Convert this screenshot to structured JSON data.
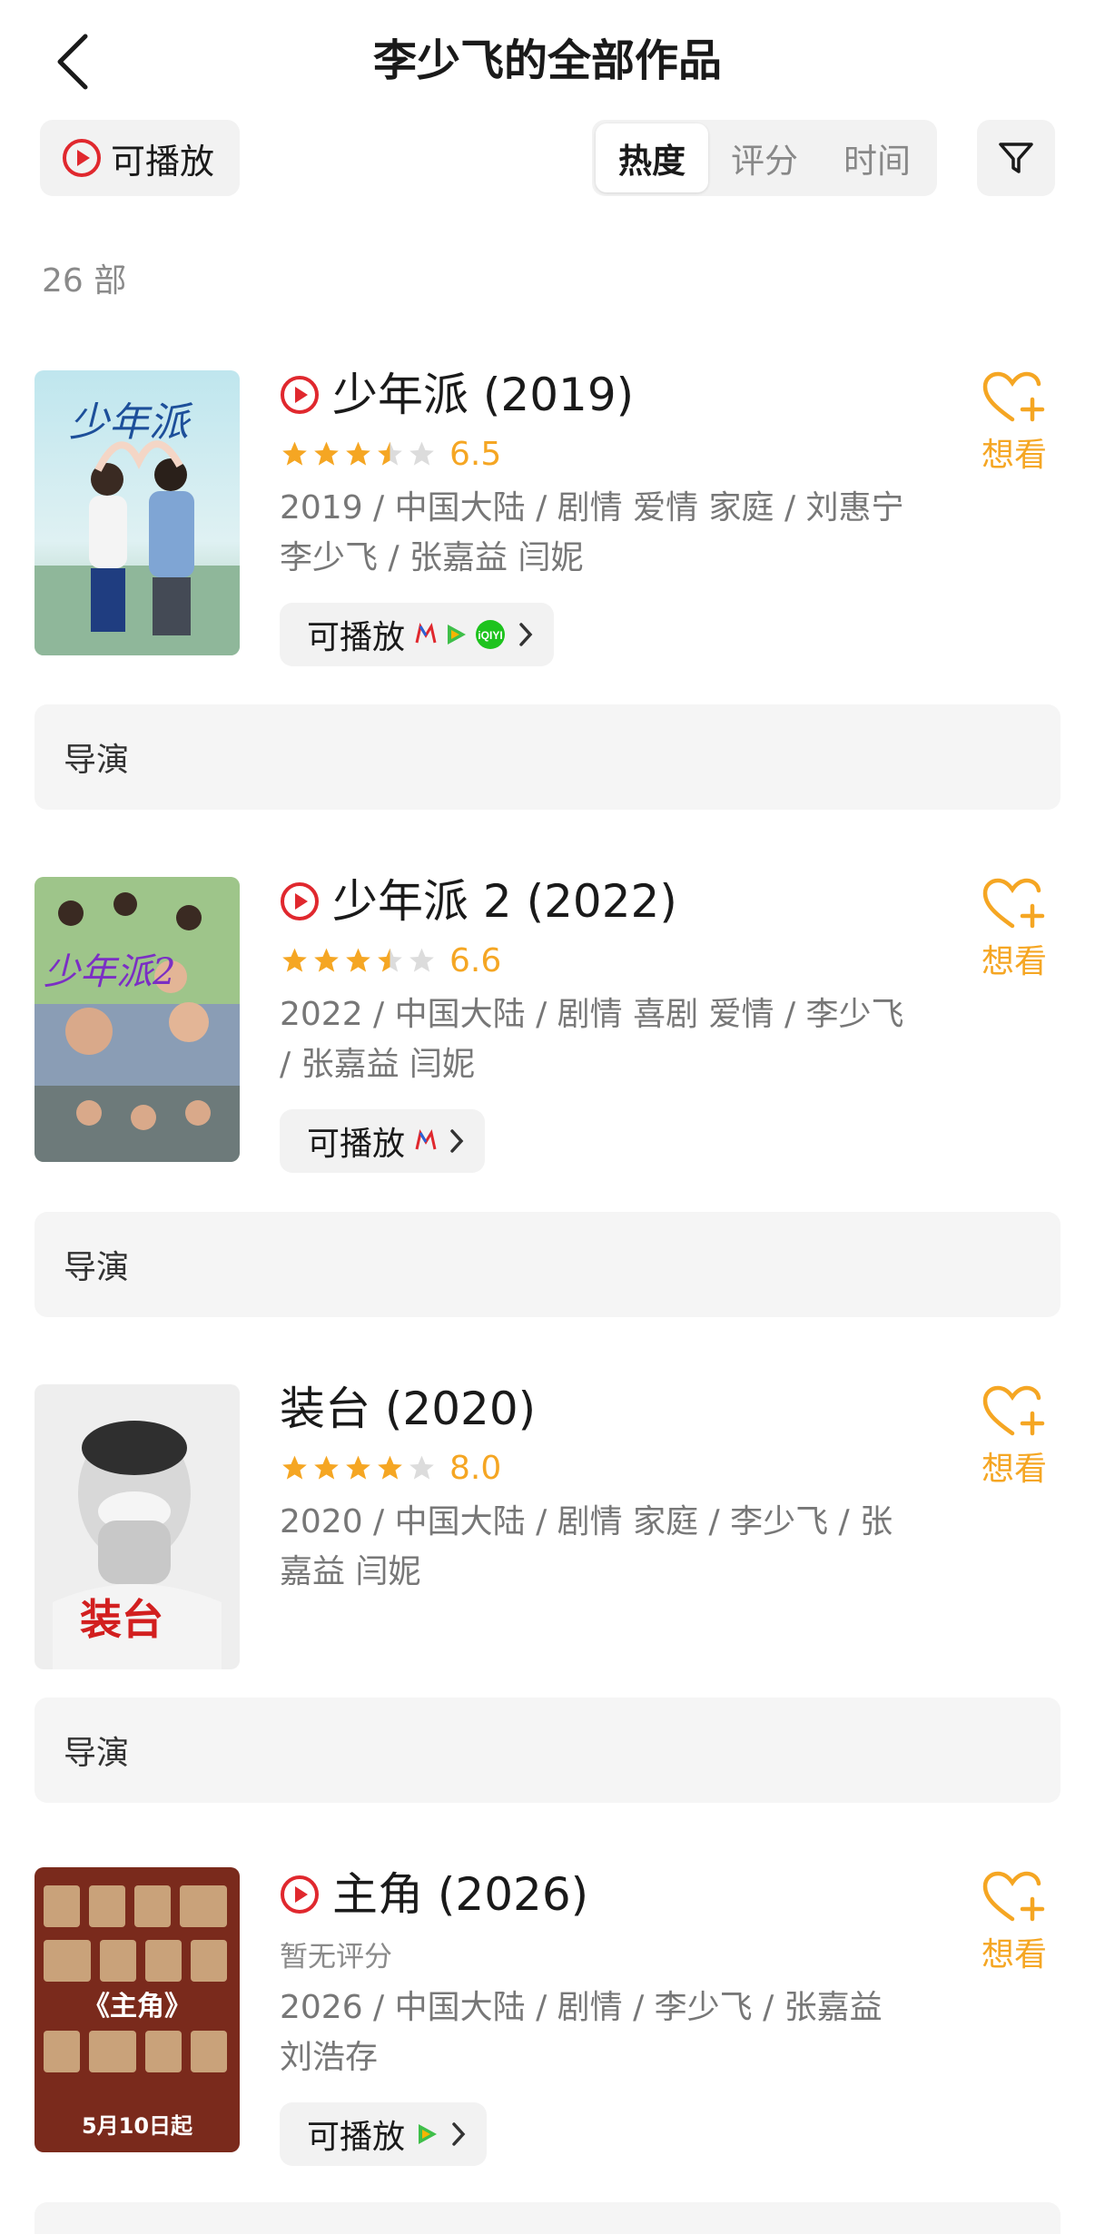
{
  "header": {
    "title": "李少飞的全部作品",
    "back_icon": "chevron-left-icon"
  },
  "toolbar": {
    "playable_label": "可播放",
    "sort_tabs": [
      {
        "label": "热度",
        "active": true
      },
      {
        "label": "评分",
        "active": false
      },
      {
        "label": "时间",
        "active": false
      }
    ],
    "filter_icon": "filter-funnel-icon"
  },
  "count_label": "26 部",
  "accent_color": "#f5a623",
  "play_icon_color": "#e0282e",
  "movies": [
    {
      "title": "少年派 (2019)",
      "has_play_icon": true,
      "rating": 6.5,
      "rating_text": "6.5",
      "meta": "2019 / 中国大陆 / 剧情 爱情 家庭 / 刘惠宁 李少飞 / 张嘉益 闫妮",
      "playable_label": "可播放",
      "platforms": [
        "mango-tv-logo",
        "tencent-video-logo",
        "iqiyi-logo"
      ],
      "want_label": "想看",
      "role": "导演"
    },
    {
      "title": "少年派 2 (2022)",
      "has_play_icon": true,
      "rating": 6.6,
      "rating_text": "6.6",
      "meta": "2022 / 中国大陆 / 剧情 喜剧 爱情 / 李少飞 / 张嘉益 闫妮",
      "playable_label": "可播放",
      "platforms": [
        "mango-tv-logo"
      ],
      "want_label": "想看",
      "role": "导演"
    },
    {
      "title": "装台 (2020)",
      "has_play_icon": false,
      "rating": 8.0,
      "rating_text": "8.0",
      "meta": "2020 / 中国大陆 / 剧情 家庭 / 李少飞 / 张嘉益 闫妮",
      "want_label": "想看",
      "role": "导演"
    },
    {
      "title": "主角 (2026)",
      "has_play_icon": true,
      "rating_text": "暂无评分",
      "meta": "2026 / 中国大陆 / 剧情 / 李少飞 / 张嘉益 刘浩存",
      "playable_label": "可播放",
      "platforms": [
        "tencent-video-logo"
      ],
      "want_label": "想看",
      "poster_text": {
        "title": "《主角》",
        "date": "5月10日起"
      }
    }
  ]
}
